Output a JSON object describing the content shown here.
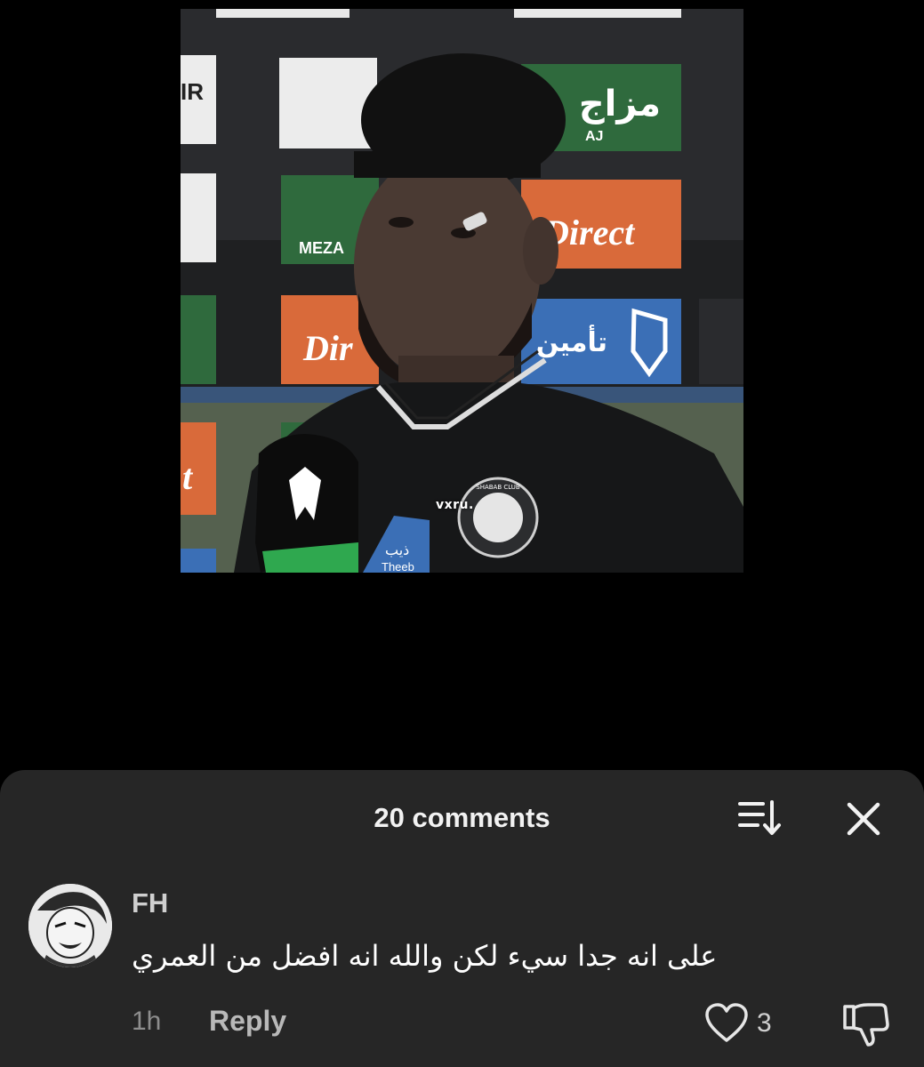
{
  "video": {
    "watermark": "vxru.",
    "sponsor_texts": {
      "mazaj_ar": "مزاج",
      "mazaj_en": "AJ",
      "direct": "Direct",
      "dir": "Dir",
      "meza": "MEZA",
      "tameeni_ar": "تأمين",
      "ir": "IR",
      "t": "t"
    },
    "badge_texts": {
      "club_name": "SHABAB CLUB",
      "sleeve_ar": "ذيب",
      "sleeve_en": "Theeb"
    },
    "colors": {
      "board_green": "#2f6a3d",
      "board_orange": "#d96a3a",
      "board_blue": "#3b6fb6",
      "jersey": "#161718",
      "mic_green": "#2fa84f"
    }
  },
  "comments": {
    "title": "20 comments",
    "sort_icon": "sort-icon",
    "close_icon": "close-icon",
    "items": [
      {
        "username": "FH",
        "text": "على انه جدا سيء لكن والله انه افضل من العمري",
        "time": "1h",
        "reply_label": "Reply",
        "likes": "3",
        "like_icon": "heart-icon",
        "dislike_icon": "thumbs-down-icon"
      }
    ]
  }
}
